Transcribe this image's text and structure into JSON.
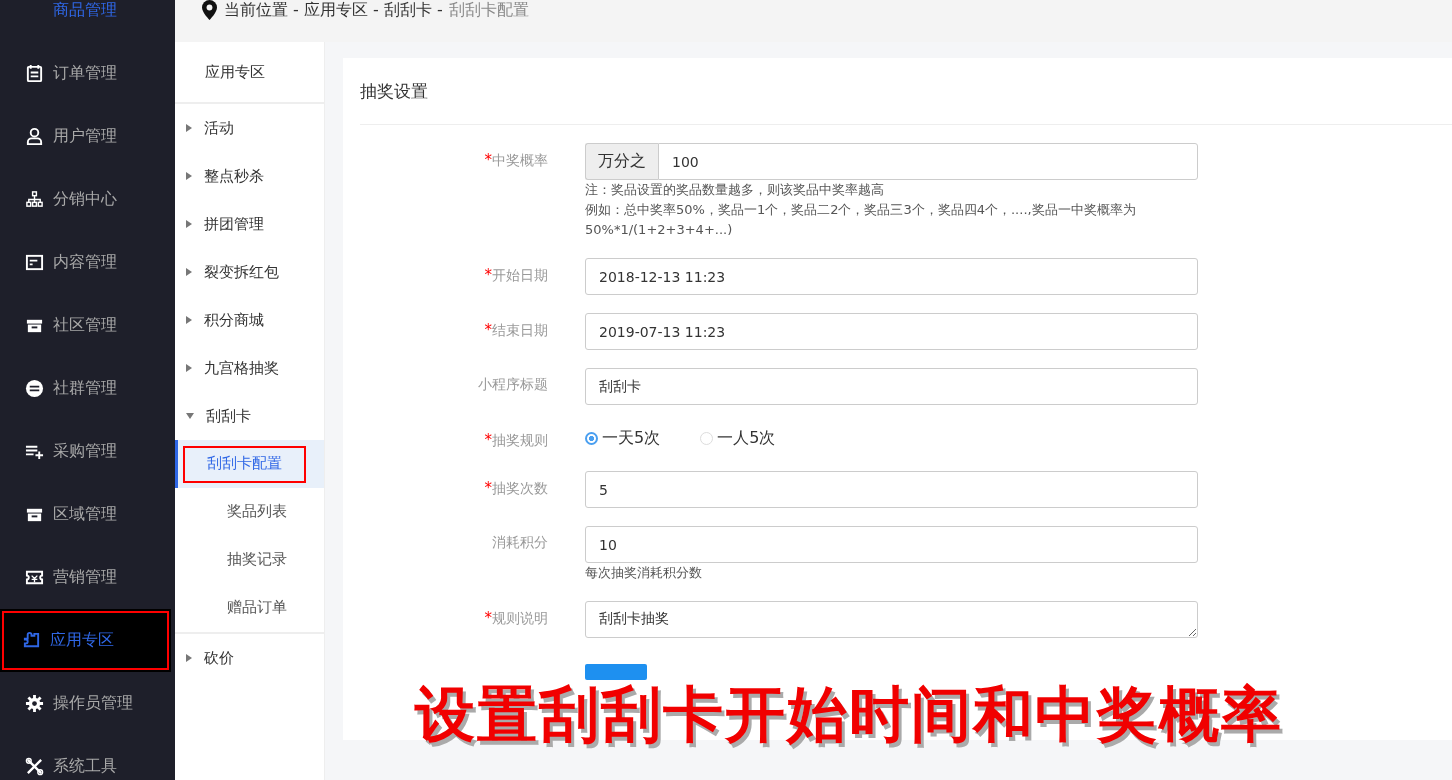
{
  "main_nav": [
    {
      "label": "商品管理",
      "selected": false,
      "highlighted": false
    },
    {
      "label": "订单管理",
      "selected": false,
      "highlighted": false
    },
    {
      "label": "用户管理",
      "selected": false,
      "highlighted": false
    },
    {
      "label": "分销中心",
      "selected": false,
      "highlighted": false
    },
    {
      "label": "内容管理",
      "selected": false,
      "highlighted": false
    },
    {
      "label": "社区管理",
      "selected": false,
      "highlighted": false
    },
    {
      "label": "社群管理",
      "selected": false,
      "highlighted": false
    },
    {
      "label": "采购管理",
      "selected": false,
      "highlighted": false
    },
    {
      "label": "区域管理",
      "selected": false,
      "highlighted": false
    },
    {
      "label": "营销管理",
      "selected": false,
      "highlighted": false
    },
    {
      "label": "应用专区",
      "selected": true,
      "highlighted": true
    },
    {
      "label": "操作员管理",
      "selected": false,
      "highlighted": false
    },
    {
      "label": "系统工具",
      "selected": false,
      "highlighted": false
    }
  ],
  "breadcrumb": "当前位置 - 应用专区 - 刮刮卡 -",
  "breadcrumb_current": "刮刮卡配置",
  "sub_nav": {
    "title": "应用专区",
    "groups": [
      {
        "label": "活动",
        "expanded": false
      },
      {
        "label": "整点秒杀",
        "expanded": false
      },
      {
        "label": "拼团管理",
        "expanded": false
      },
      {
        "label": "裂变拆红包",
        "expanded": false
      },
      {
        "label": "积分商城",
        "expanded": false
      },
      {
        "label": "九宫格抽奖",
        "expanded": false
      },
      {
        "label": "刮刮卡",
        "expanded": true,
        "children": [
          {
            "label": "刮刮卡配置",
            "selected": true,
            "highlighted": true
          },
          {
            "label": "奖品列表",
            "selected": false,
            "highlighted": false
          },
          {
            "label": "抽奖记录",
            "selected": false,
            "highlighted": false
          },
          {
            "label": "赠品订单",
            "selected": false,
            "highlighted": false
          }
        ]
      },
      {
        "label": "砍价",
        "expanded": false
      }
    ]
  },
  "card_title": "抽奖设置",
  "form": [
    {
      "kind": "prefixed",
      "mark": "*",
      "label": "中奖概率",
      "prefix": "万分之",
      "value": "100",
      "hints": [
        "注：奖品设置的奖品数量越多，则该奖品中奖率越高",
        "例如：总中奖率50%，奖品一1个，奖品二2个，奖品三3个，奖品四4个，....,奖品一中奖概率为50%*1/(1+2+3+4+...)"
      ]
    },
    {
      "kind": "text",
      "mark": "*",
      "label": "开始日期",
      "value": "2018-12-13 11:23"
    },
    {
      "kind": "text",
      "mark": "*",
      "label": "结束日期",
      "value": "2019-07-13 11:23"
    },
    {
      "kind": "text",
      "label": "小程序标题",
      "value": "刮刮卡"
    },
    {
      "kind": "radio",
      "mark": "*",
      "label": "抽奖规则",
      "options": [
        {
          "label": "一天5次",
          "selected": true
        },
        {
          "label": "一人5次",
          "selected": false
        }
      ]
    },
    {
      "kind": "text",
      "mark": "*",
      "label": "抽奖次数",
      "value": "5"
    },
    {
      "kind": "text",
      "label": "消耗积分",
      "value": "10",
      "hints": [
        "每次抽奖消耗积分数"
      ]
    },
    {
      "kind": "textarea",
      "mark": "*",
      "label": "规则说明",
      "value": "刮刮卡抽奖"
    }
  ],
  "caption": "设置刮刮卡开始时间和中奖概率"
}
